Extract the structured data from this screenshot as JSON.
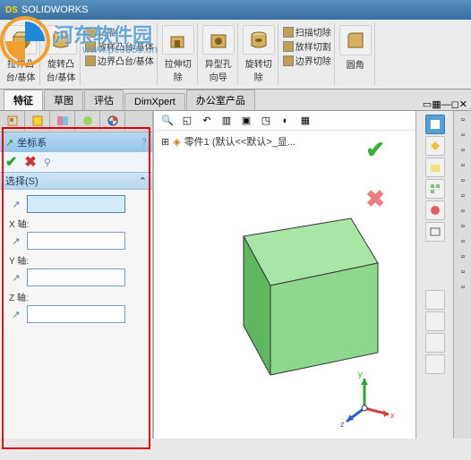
{
  "app": {
    "title": "SOLIDWORKS",
    "ds": "DS"
  },
  "watermark": {
    "text": "河东软件园",
    "url": "www.pc0359.cn"
  },
  "toolbar": {
    "items": [
      {
        "label": "拉伸凸\n台/基体"
      },
      {
        "label": "旋转凸\n台/基体"
      }
    ],
    "sub_group": [
      "扫描",
      "放样凸台/基体",
      "边界凸台/基体"
    ],
    "items2": [
      {
        "label": "拉伸切\n除"
      },
      {
        "label": "异型孔\n向导"
      },
      {
        "label": "旋转切\n除"
      }
    ],
    "sub_group2": [
      "扫描切除",
      "放样切割",
      "边界切除"
    ],
    "fillet": "圆角"
  },
  "tabs": [
    "特征",
    "草图",
    "评估",
    "DimXpert",
    "办公室产品"
  ],
  "active_tab": 0,
  "tree": {
    "root": "零件1  (默认<<默认>_显..."
  },
  "property_panel": {
    "title": "坐标系",
    "selection_header": "选择(S)",
    "origin": {
      "value": ""
    },
    "x_axis": {
      "label": "X 轴:",
      "value": ""
    },
    "y_axis": {
      "label": "Y 轴:",
      "value": ""
    },
    "z_axis": {
      "label": "Z 轴:",
      "value": ""
    }
  },
  "colors": {
    "cube_face": "#8dd88d",
    "cube_top": "#a8e6a8",
    "cube_side": "#5fb85f",
    "accent": "#5a9fd4"
  },
  "triad": {
    "x": "x",
    "y": "y",
    "z": "z"
  }
}
